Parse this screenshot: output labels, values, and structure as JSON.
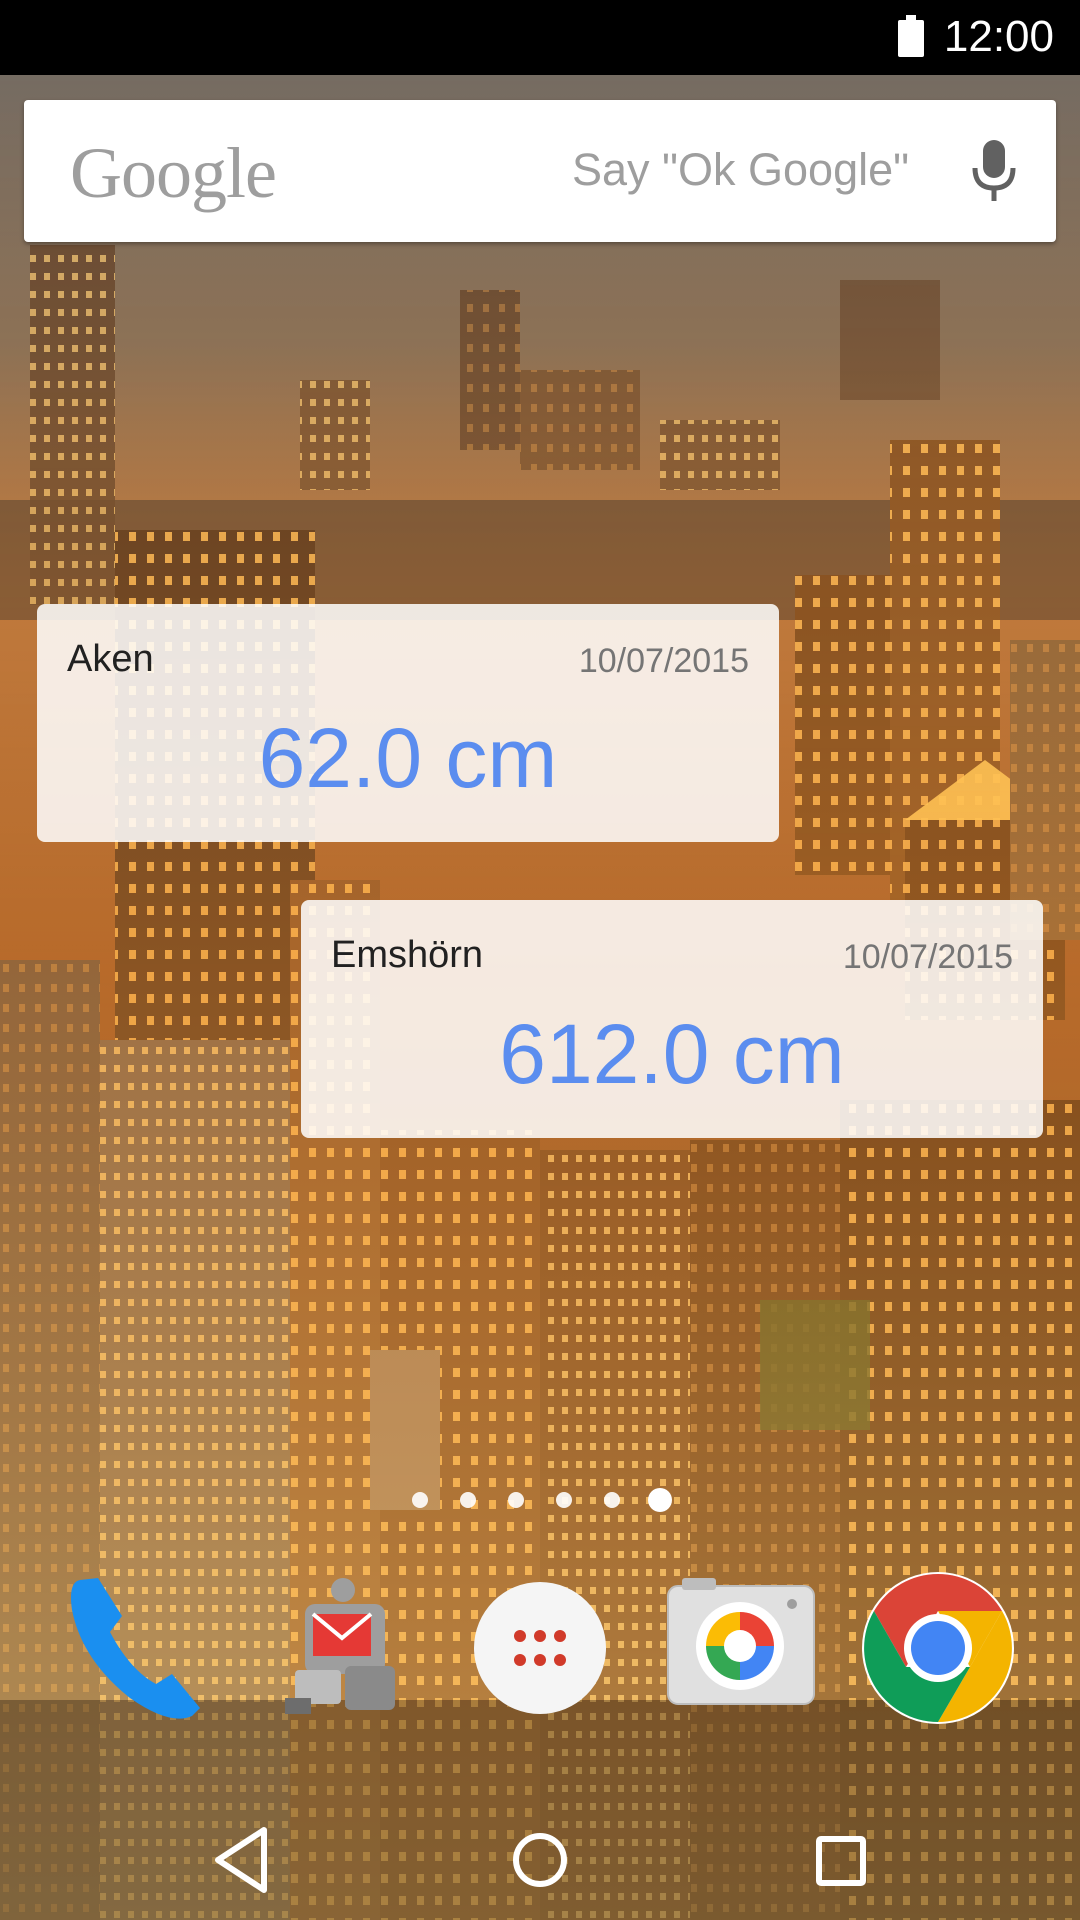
{
  "status_bar": {
    "time": "12:00",
    "battery_icon": "battery-full-icon"
  },
  "search": {
    "logo_text": "Google",
    "hint": "Say \"Ok Google\"",
    "mic_icon": "mic-icon"
  },
  "widgets": [
    {
      "station": "Aken",
      "date": "10/07/2015",
      "value": "62.0 cm"
    },
    {
      "station": "Emshörn",
      "date": "10/07/2015",
      "value": "612.0 cm"
    }
  ],
  "home_pages": {
    "count": 6,
    "active_index": 5
  },
  "dock": {
    "apps": [
      {
        "icon": "phone-icon"
      },
      {
        "icon": "robot-mail-icon"
      },
      {
        "icon": "app-drawer-icon"
      },
      {
        "icon": "photos-icon"
      },
      {
        "icon": "chrome-icon"
      }
    ]
  },
  "nav_bar": {
    "buttons": [
      {
        "icon": "back-icon"
      },
      {
        "icon": "home-icon"
      },
      {
        "icon": "recents-icon"
      }
    ]
  },
  "colors": {
    "widget_value": "#5b8def",
    "status_bar": "#000000"
  }
}
